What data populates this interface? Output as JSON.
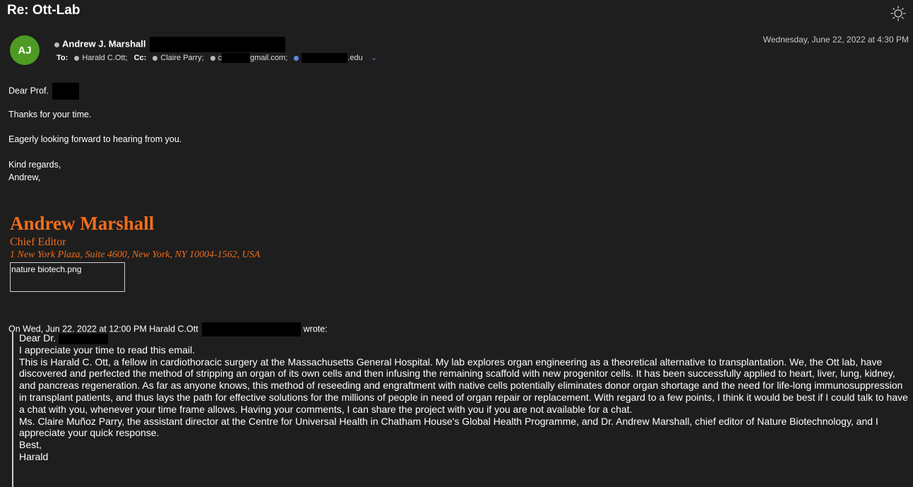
{
  "subject": "Re: Ott-Lab",
  "header": {
    "avatar_initials": "AJ",
    "sender_name": "Andrew J. Marshall",
    "date": "Wednesday, June 22, 2022 at 4:30 PM",
    "to_label": "To:",
    "to_name": "Harald C.Ott;",
    "cc_label": "Cc:",
    "cc_names": [
      "Claire Parry;",
      "c",
      "gmail.com;",
      ".edu"
    ]
  },
  "body": {
    "greeting": "Dear Prof.",
    "line1": "Thanks for your time.",
    "line2": "Eagerly looking forward to hearing from you.",
    "closing1": "Kind regards,",
    "closing2": "Andrew,"
  },
  "signature": {
    "name": "Andrew Marshall",
    "title": "Chief Editor",
    "address": "1 New York Plaza, Suite 4600, New York, NY 10004-1562, USA",
    "image_placeholder": "nature biotech.png"
  },
  "quoted": {
    "intro_prefix": "On Wed, Jun 22. 2022 at 12:00 PM Harald C.Ott",
    "intro_suffix": "wrote:",
    "greeting": "Dear Dr.",
    "p1": "I appreciate your time to read this email.",
    "p2": "This is Harald C. Ott, a fellow in cardiothoracic surgery at the Massachusetts General Hospital. My lab explores organ engineering as a theoretical alternative to transplantation. We, the Ott lab, have discovered and perfected the method of stripping an organ of its own cells and then infusing the remaining scaffold with new progenitor cells. It has been successfully applied to heart, liver, lung, kidney, and pancreas regeneration. As far as anyone knows, this method of reseeding and engraftment with native cells potentially eliminates donor organ shortage and the need for life-long immunosuppression in transplant patients, and thus lays the path for effective solutions for the millions of people in need of organ repair or replacement. With regard to a few points, I think it would be best if I could talk to have a chat with you, whenever your time frame allows. Having your comments, I can share the project with you if you are not available for a chat.",
    "p3": "Ms. Claire Muñoz Parry, the assistant director at the Centre for Universal Health in Chatham House's Global Health Programme, and Dr. Andrew Marshall, chief editor of Nature Biotechnology, and I appreciate your quick response.",
    "closing1": "Best,",
    "closing2": "Harald"
  },
  "colors": {
    "background": "#1e1e1e",
    "avatar": "#4e9a22",
    "signature": "#f06d1c",
    "chevron": "#4a8cf0"
  }
}
